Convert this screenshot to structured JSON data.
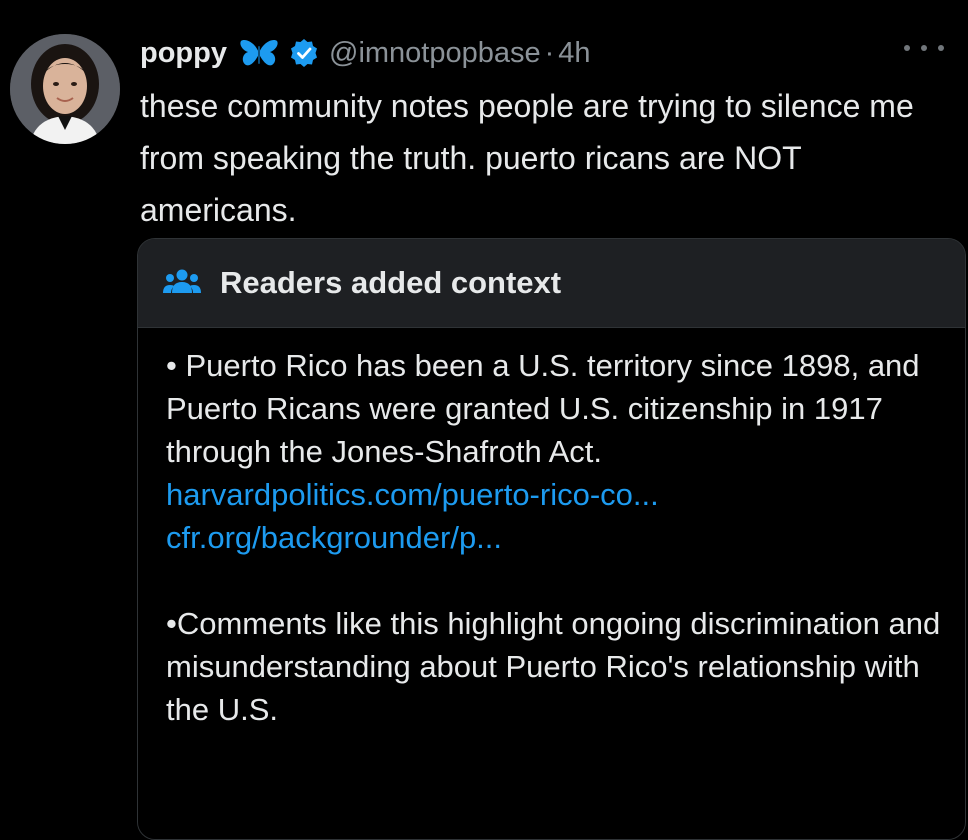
{
  "tweet": {
    "display_name": "poppy",
    "handle": "@imnotpopbase",
    "separator": "·",
    "time": "4h",
    "text": "these community notes people are trying to silence me from speaking the truth. puerto ricans are NOT americans.",
    "icons": {
      "avatar": "profile-photo",
      "butterfly": "butterfly-emoji",
      "verified": "verified-badge-icon",
      "more": "more-options-icon"
    }
  },
  "community_note": {
    "title": "Readers added context",
    "icon": "people-icon",
    "point_1": "• Puerto Rico has been a U.S. territory since 1898, and Puerto Ricans were granted U.S. citizenship in 1917 through the Jones-Shafroth Act.",
    "links": [
      "harvardpolitics.com/puerto-rico-co...",
      "cfr.org/backgrounder/p..."
    ],
    "point_2": "•Comments like this highlight ongoing discrimination and misunderstanding about Puerto Rico's relationship with the U.S."
  },
  "colors": {
    "background": "#000000",
    "text": "#e7e9ea",
    "secondary_text": "#8b9298",
    "link": "#1d9bf0",
    "verified": "#1d9bf0",
    "butterfly": "#1d9bf0"
  }
}
